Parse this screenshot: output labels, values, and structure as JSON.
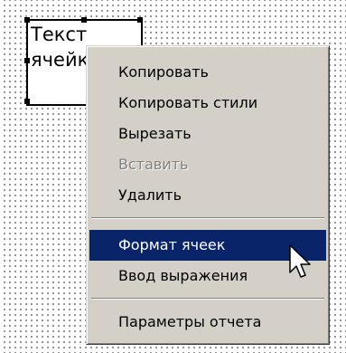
{
  "cell": {
    "text": "Текст\nячейки"
  },
  "context_menu": {
    "items": [
      {
        "label": "Копировать",
        "enabled": true
      },
      {
        "label": "Копировать стили",
        "enabled": true
      },
      {
        "label": "Вырезать",
        "enabled": true
      },
      {
        "label": "Вставить",
        "enabled": false
      },
      {
        "label": "Удалить",
        "enabled": true
      },
      {
        "label": "Формат ячеек",
        "enabled": true,
        "highlighted": true
      },
      {
        "label": "Ввод выражения",
        "enabled": true
      },
      {
        "label": "Параметры отчета",
        "enabled": true
      }
    ]
  },
  "colors": {
    "menu_background": "#d4d0c8",
    "highlight": "#0a246a",
    "disabled_text": "#808080"
  },
  "icons": [
    "mouse-pointer-icon",
    "selection-handle"
  ]
}
